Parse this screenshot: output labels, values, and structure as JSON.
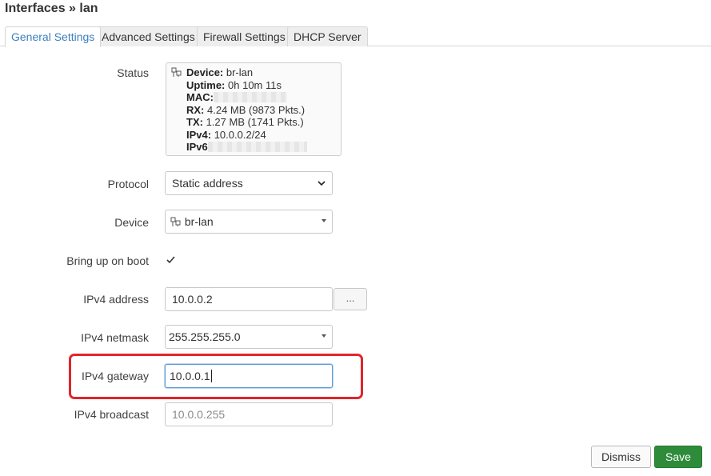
{
  "page": {
    "title": "Interfaces » lan"
  },
  "tabs": [
    {
      "label": "General Settings",
      "active": true
    },
    {
      "label": "Advanced Settings",
      "active": false
    },
    {
      "label": "Firewall Settings",
      "active": false
    },
    {
      "label": "DHCP Server",
      "active": false
    }
  ],
  "status": {
    "label": "Status",
    "device_key": "Device:",
    "device_val": "br-lan",
    "uptime_key": "Uptime:",
    "uptime_val": "0h 10m 11s",
    "mac_key": "MAC:",
    "rx_key": "RX:",
    "rx_val": "4.24 MB (9873 Pkts.)",
    "tx_key": "TX:",
    "tx_val": "1.27 MB (1741 Pkts.)",
    "ipv4_key": "IPv4:",
    "ipv4_val": "10.0.0.2/24",
    "ipv6_key": "IPv6"
  },
  "protocol": {
    "label": "Protocol",
    "value": "Static address"
  },
  "device": {
    "label": "Device",
    "value": "br-lan",
    "icon": "network-bridge-icon"
  },
  "boot": {
    "label": "Bring up on boot",
    "checked": true
  },
  "ipv4_address": {
    "label": "IPv4 address",
    "value": "10.0.0.2",
    "button": "..."
  },
  "ipv4_netmask": {
    "label": "IPv4 netmask",
    "value": "255.255.255.0"
  },
  "ipv4_gateway": {
    "label": "IPv4 gateway",
    "value": "10.0.0.1"
  },
  "ipv4_broadcast": {
    "label": "IPv4 broadcast",
    "placeholder": "10.0.0.255"
  },
  "actions": {
    "dismiss": "Dismiss",
    "save": "Save"
  },
  "colors": {
    "highlight": "#e0262b",
    "save": "#2e8b3a",
    "active_tab": "#3d7fc0"
  }
}
